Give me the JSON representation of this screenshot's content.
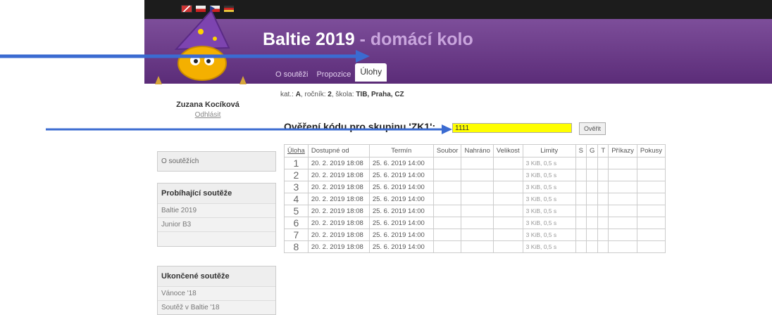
{
  "header": {
    "title": "Baltie 2019",
    "subtitle": "- domácí kolo",
    "tabs": [
      "O soutěži",
      "Propozice",
      "Úlohy"
    ]
  },
  "user": {
    "name": "Zuzana Kocíková",
    "logout": "Odhlásit"
  },
  "sidebar": {
    "about": "O soutěžích",
    "running_head": "Probíhající soutěže",
    "running": [
      "Baltie 2019",
      "Junior B3"
    ],
    "finished_head": "Ukončené soutěže",
    "finished": [
      "Vánoce '18",
      "Soutěž v Baltie '18"
    ]
  },
  "info": {
    "kat_label": "kat.:",
    "kat": "A",
    "rocnik_label": "ročník:",
    "rocnik": "2",
    "skola_label": "škola:",
    "skola": "TIB, Praha, CZ"
  },
  "verify": {
    "label": "Ověření kódu pro skupinu 'ZK1':",
    "value": "1111",
    "button": "Ověřit"
  },
  "table": {
    "headers": [
      "Úloha",
      "Dostupné od",
      "Termín",
      "Soubor",
      "Nahráno",
      "Velikost",
      "Limity",
      "S",
      "G",
      "T",
      "Příkazy",
      "Pokusy"
    ],
    "rows": [
      {
        "n": "1",
        "od": "20. 2. 2019 18:08",
        "termin": "25. 6. 2019 14:00",
        "limity": "3 KiB, 0,5 s"
      },
      {
        "n": "2",
        "od": "20. 2. 2019 18:08",
        "termin": "25. 6. 2019 14:00",
        "limity": "3 KiB, 0,5 s"
      },
      {
        "n": "3",
        "od": "20. 2. 2019 18:08",
        "termin": "25. 6. 2019 14:00",
        "limity": "3 KiB, 0,5 s"
      },
      {
        "n": "4",
        "od": "20. 2. 2019 18:08",
        "termin": "25. 6. 2019 14:00",
        "limity": "3 KiB, 0,5 s"
      },
      {
        "n": "5",
        "od": "20. 2. 2019 18:08",
        "termin": "25. 6. 2019 14:00",
        "limity": "3 KiB, 0,5 s"
      },
      {
        "n": "6",
        "od": "20. 2. 2019 18:08",
        "termin": "25. 6. 2019 14:00",
        "limity": "3 KiB, 0,5 s"
      },
      {
        "n": "7",
        "od": "20. 2. 2019 18:08",
        "termin": "25. 6. 2019 14:00",
        "limity": "3 KiB, 0,5 s"
      },
      {
        "n": "8",
        "od": "20. 2. 2019 18:08",
        "termin": "25. 6. 2019 14:00",
        "limity": "3 KiB, 0,5 s"
      }
    ]
  },
  "colors": {
    "header_purple": "#6a3a88",
    "highlight_yellow": "#ffff00",
    "arrow_blue": "#3b6bd1"
  },
  "icons": [
    "flag-gb-icon",
    "flag-pl-icon",
    "flag-cz-icon",
    "flag-de-icon",
    "wizard-mascot"
  ]
}
